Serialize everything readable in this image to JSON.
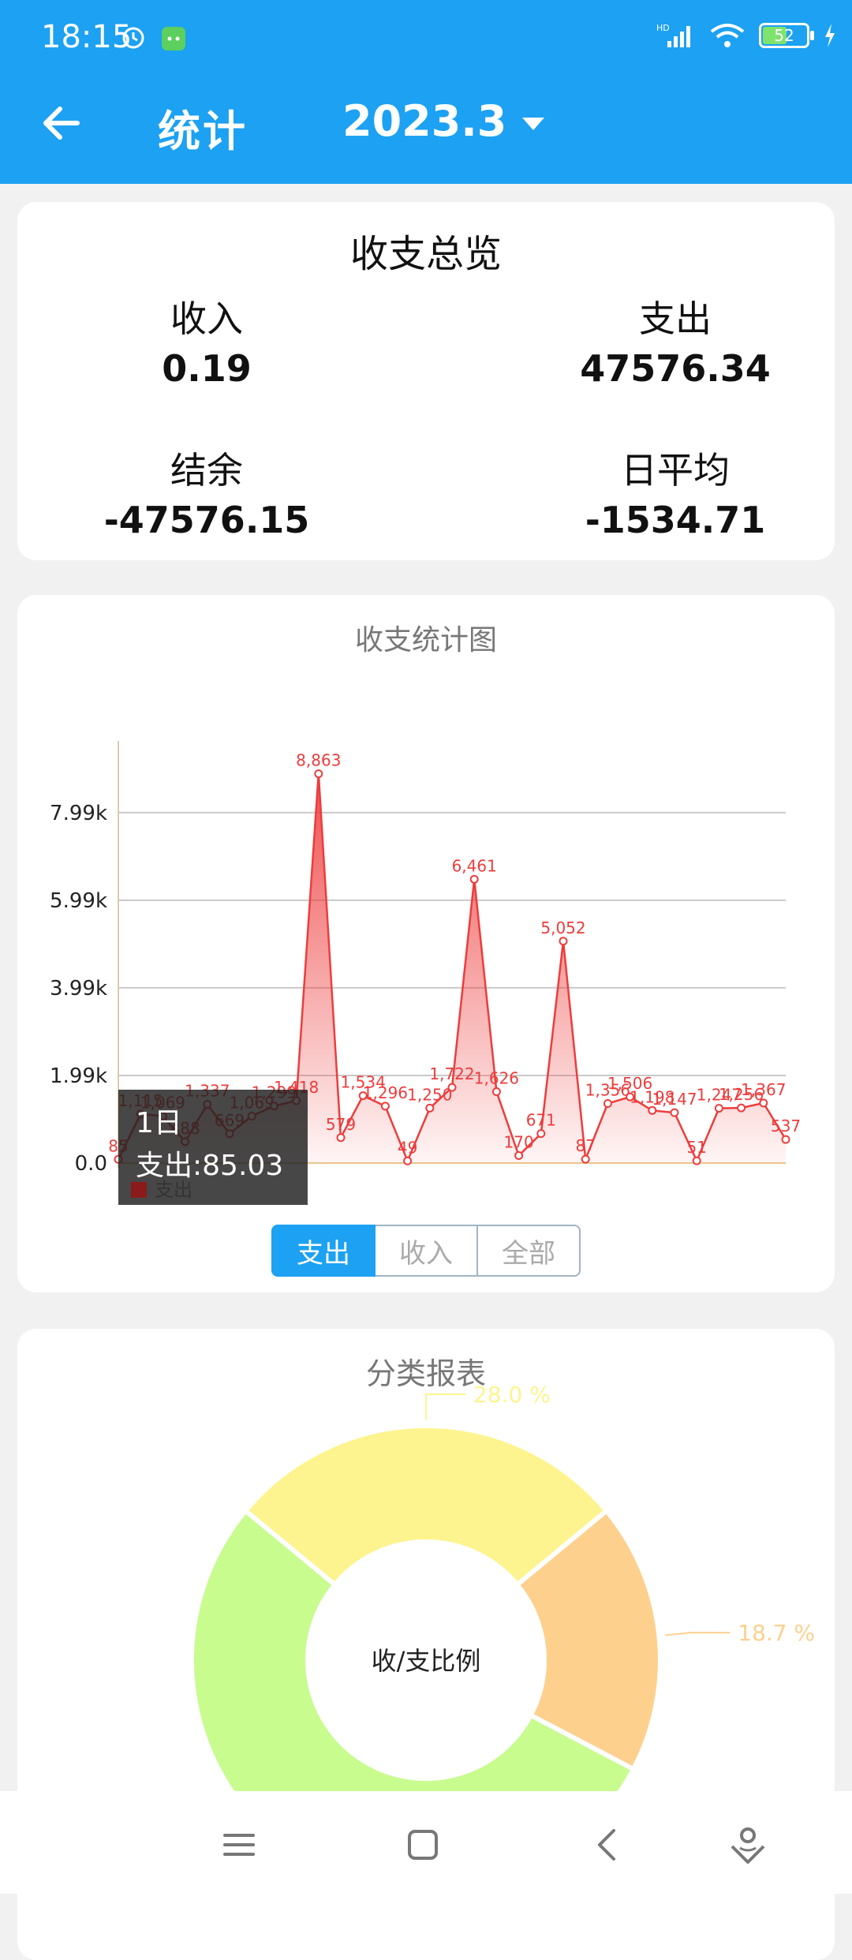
{
  "status": {
    "time": "18:15",
    "network": "HD",
    "battery": "52"
  },
  "header": {
    "title": "统计",
    "month": "2023.3"
  },
  "overview": {
    "title": "收支总览",
    "income_label": "收入",
    "income_value": "0.19",
    "expense_label": "支出",
    "expense_value": "47576.34",
    "balance_label": "结余",
    "balance_value": "-47576.15",
    "daily_avg_label": "日平均",
    "daily_avg_value": "-1534.71"
  },
  "stats_chart": {
    "title": "收支统计图",
    "tooltip_day": "1日",
    "tooltip_value": "支出:85.03",
    "legend": "支出",
    "tabs": [
      "支出",
      "收入",
      "全部"
    ],
    "active_tab": "支出"
  },
  "chart_data": {
    "type": "area",
    "x": [
      1,
      2,
      3,
      4,
      5,
      6,
      7,
      8,
      9,
      10,
      11,
      12,
      13,
      14,
      15,
      16,
      17,
      18,
      19,
      20,
      21,
      22,
      23,
      24,
      25,
      26,
      27,
      28,
      29,
      30,
      31
    ],
    "series": [
      {
        "name": "支出",
        "values": [
          85,
          1115,
          1069,
          488,
          1337,
          669,
          1069,
          1299,
          1418,
          8863,
          579,
          1534,
          1296,
          49,
          1250,
          1722,
          6461,
          1626,
          170,
          671,
          5052,
          87,
          1356,
          1506,
          1198,
          1147,
          51,
          1247,
          1256,
          1367,
          537
        ],
        "labels": [
          "85",
          "1,115",
          "1,069",
          "488",
          "1,337",
          "669",
          "1,069",
          "1,299",
          "1,418",
          "8,863",
          "579",
          "1,534",
          "1,296",
          "49",
          "1,250",
          "1,722",
          "6,461",
          "1,626",
          "170",
          "671",
          "5,052",
          "87",
          "1,356",
          "1,506",
          "1,198",
          "1,147",
          "51",
          "1,247",
          "1,256",
          "1,367",
          "537"
        ],
        "color": "#ee3c3c"
      }
    ],
    "yticks": [
      "0.0",
      "1.99k",
      "3.99k",
      "5.99k",
      "7.99k"
    ],
    "ytick_values": [
      0,
      1994,
      3989,
      5983,
      7977
    ],
    "ylim": [
      0,
      9700
    ],
    "grid": true
  },
  "category_report": {
    "title": "分类报表",
    "center_label": "收/支比例",
    "slices": [
      {
        "label": "28.0 %",
        "percent": 28.0,
        "color": "#fdf48f"
      },
      {
        "label": "18.7 %",
        "percent": 18.7,
        "color": "#fdd08e"
      },
      {
        "label": "",
        "percent": 53.3,
        "color": "#c8fc8f"
      }
    ]
  }
}
